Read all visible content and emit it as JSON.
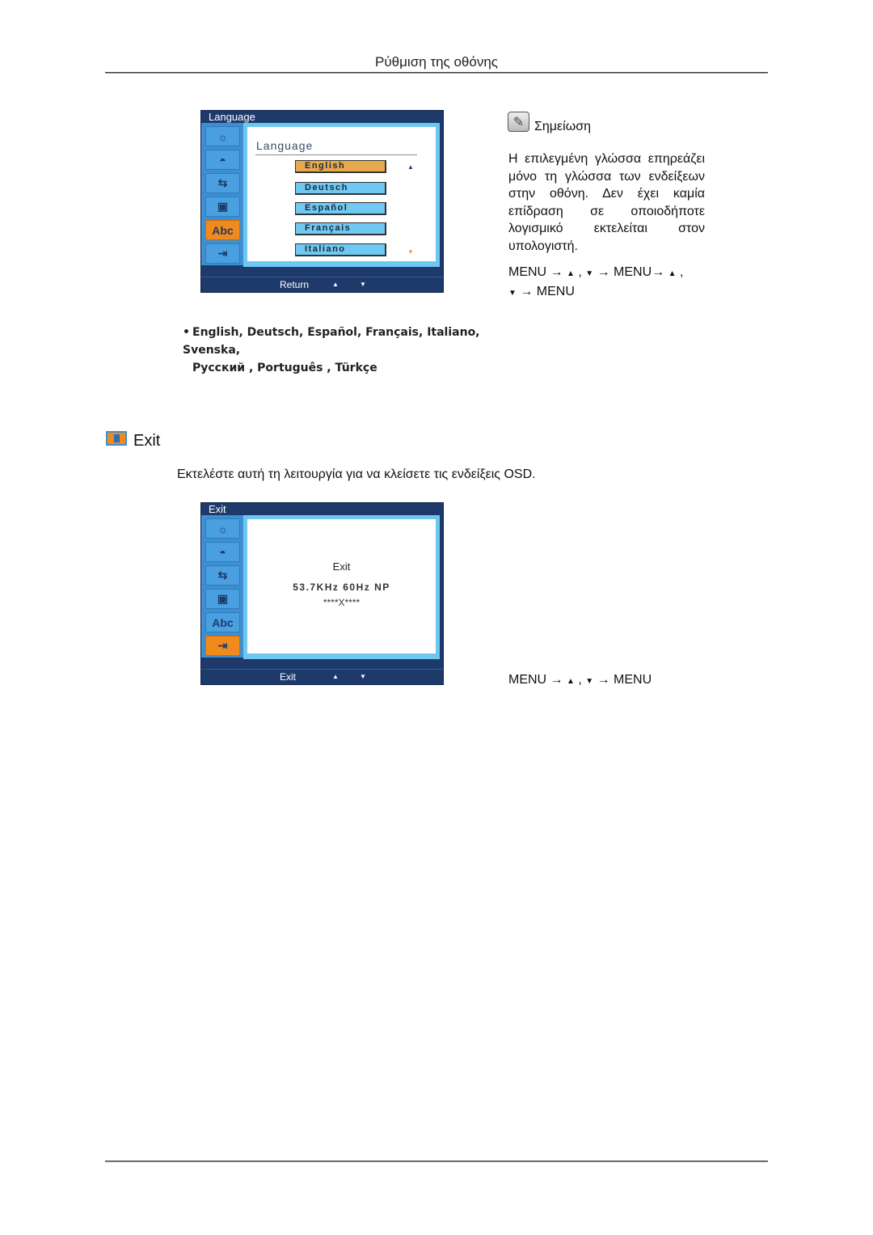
{
  "page": {
    "header_title": "Ρύθμιση της οθόνης"
  },
  "osd_language": {
    "window_title": "Language",
    "heading": "Language",
    "sidebar": [
      {
        "icon": "brightness-icon",
        "glyph": "☼",
        "active": false
      },
      {
        "icon": "color-icon",
        "glyph": "◓",
        "active": false
      },
      {
        "icon": "image-setup-icon",
        "glyph": "⇆",
        "active": false
      },
      {
        "icon": "osd-icon",
        "glyph": "▣",
        "active": false
      },
      {
        "icon": "language-abc-icon",
        "glyph": "Abc",
        "active": true
      },
      {
        "icon": "exit-icon",
        "glyph": "⇥",
        "active": false
      }
    ],
    "options": [
      {
        "label": "English",
        "selected": true
      },
      {
        "label": "Deutsch",
        "selected": false
      },
      {
        "label": "Español",
        "selected": false
      },
      {
        "label": "Français",
        "selected": false
      },
      {
        "label": "Italiano",
        "selected": false
      }
    ],
    "scroll_up": "▲",
    "scroll_down": "▼",
    "footer": {
      "label": "Return",
      "up": "▲",
      "down": "▼"
    }
  },
  "note": {
    "title": "Σημείωση",
    "body": "Η επιλεγμένη γλώσσα επηρεάζει μόνο τη γλώσσα των ενδείξεων στην οθόνη. Δεν έχει καμία επίδραση σε οποιοδήποτε λογισμικό εκτελείται στον υπολογιστή.",
    "menu_sequence": {
      "p1": "MENU → ",
      "up": "▲",
      "p2": " , ",
      "down": "▼",
      "p3": " → MENU→ ",
      "up2": "▲",
      "p4": " , ",
      "down2": "▼",
      "p5": " → MENU"
    }
  },
  "languages_list": {
    "bullet": "•",
    "line1": "English, Deutsch, Español, Français,  Italiano, Svenska,",
    "line2": "Русский , Português , Türkçe"
  },
  "exit_section": {
    "title": "Exit",
    "description": "Εκτελέστε αυτή τη λειτουργία για να κλείσετε τις ενδείξεις OSD.",
    "osd": {
      "window_title": "Exit",
      "line1": "Exit",
      "line2": "53.7KHz 60Hz NP",
      "line3": "****X****",
      "footer": {
        "label": "Exit",
        "up": "▲",
        "down": "▼"
      }
    },
    "menu_sequence": {
      "p1": "MENU → ",
      "up": "▲",
      "p2": " , ",
      "down": "▼",
      "p3": " → MENU"
    }
  },
  "colors": {
    "osd_frame": "#1e3a6b",
    "osd_sidebar": "#3d8fd1",
    "osd_active": "#f08a1c",
    "osd_option": "#6fc9f2",
    "osd_option_selected": "#e8a94e"
  }
}
